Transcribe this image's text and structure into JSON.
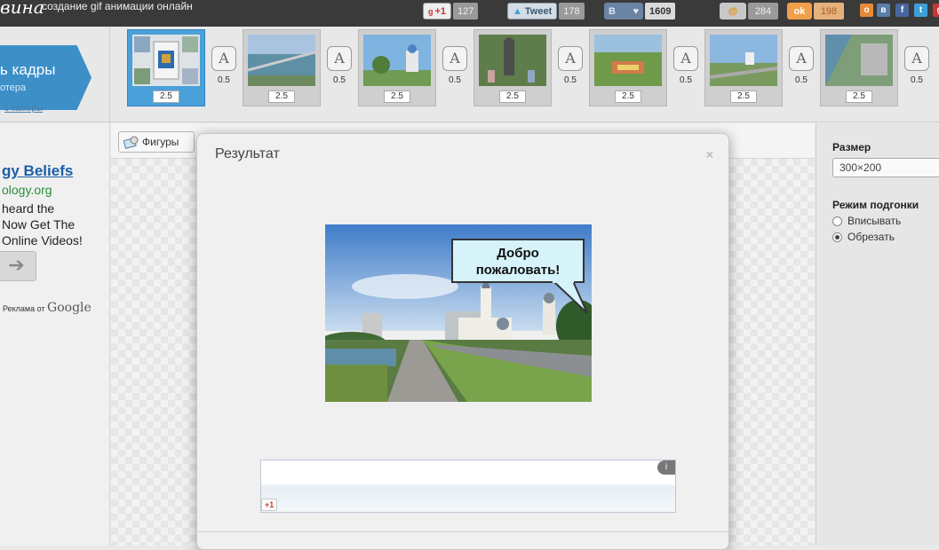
{
  "header": {
    "logo": "вина",
    "tagline": "создание gif анимации онлайн",
    "social": {
      "gplus_label": "+1",
      "gplus_count": "127",
      "tweet_label": "Tweet",
      "tweet_count": "178",
      "vk_label": "B",
      "vk_count": "1609",
      "mail_count": "284",
      "ok_count": "198"
    },
    "mini_icons": [
      "odnoklassniki-icon",
      "vk-icon",
      "facebook-icon",
      "twitter-icon"
    ]
  },
  "strip": {
    "add_frames_title": "ь кадры",
    "add_frames_sub": "отера",
    "camera_link": "с камеры",
    "frames": [
      {
        "duration": "2.5",
        "transition": "0.5"
      },
      {
        "duration": "2.5",
        "transition": "0.5"
      },
      {
        "duration": "2.5",
        "transition": "0.5"
      },
      {
        "duration": "2.5",
        "transition": "0.5"
      },
      {
        "duration": "2.5",
        "transition": "0.5"
      },
      {
        "duration": "2.5",
        "transition": "0.5"
      },
      {
        "duration": "2.5",
        "transition": "0.5"
      }
    ]
  },
  "ad": {
    "title": "gy Beliefs",
    "url": "ology.org",
    "text_lines": [
      "heard the",
      "Now Get The",
      "Online Videos!"
    ],
    "by_label": "Реклама от",
    "by_brand": "Google"
  },
  "toolbar": {
    "shapes_label": "Фигуры"
  },
  "right_panel": {
    "size_label": "Размер",
    "size_value": "300×200",
    "fit_label": "Режим подгонки",
    "fit_options": [
      {
        "label": "Вписывать",
        "selected": false
      },
      {
        "label": "Обрезать",
        "selected": true
      }
    ]
  },
  "modal": {
    "title": "Результат",
    "close": "×",
    "bubble_line1": "Добро",
    "bubble_line2": "пожаловать!",
    "banner_info": "i",
    "banner_gplus": "+1"
  },
  "colors": {
    "topbar": "#3a3a3a",
    "accent_blue": "#3d8fc8",
    "link_blue": "#1a5ea8",
    "ad_url_green": "#2a8e3a",
    "bubble_fill": "#d6f3fa"
  }
}
